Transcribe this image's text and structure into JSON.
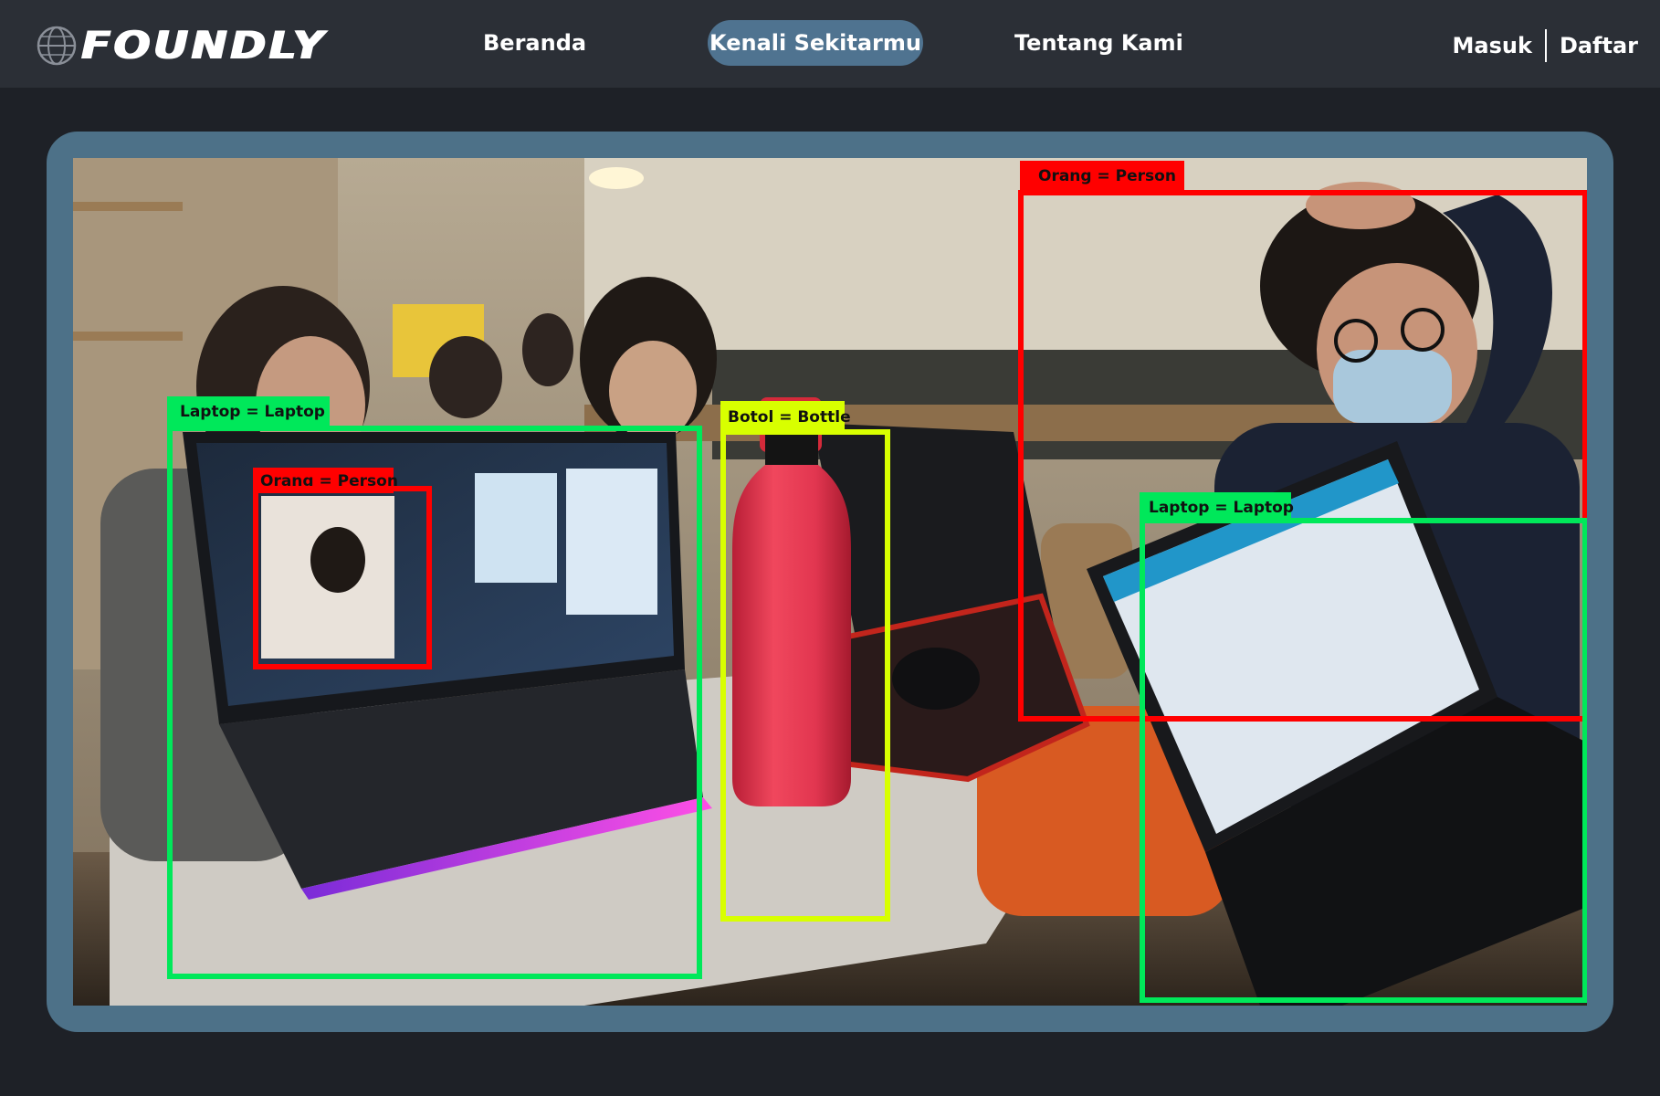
{
  "brand": {
    "name": "FOUNDLY"
  },
  "nav": {
    "items": [
      {
        "label": "Beranda",
        "active": false
      },
      {
        "label": "Kenali Sekitarmu",
        "active": true
      },
      {
        "label": "Tentang Kami",
        "active": false
      }
    ]
  },
  "auth": {
    "login_label": "Masuk",
    "register_label": "Daftar"
  },
  "detections": [
    {
      "label": "Orang = Person",
      "color": "#ff0000"
    },
    {
      "label": "Laptop = Laptop",
      "color": "#00e85a"
    },
    {
      "label": "Orang = Person",
      "color": "#ff0000"
    },
    {
      "label": "Botol = Bottle",
      "color": "#d8ff00"
    },
    {
      "label": "Laptop = Laptop",
      "color": "#00e85a"
    }
  ],
  "colors": {
    "page_background": "#1e2127",
    "navbar_background": "#2b2f36",
    "active_nav_pill": "#4f7390",
    "frame_border": "#4d7188",
    "person_box": "#ff0000",
    "laptop_box": "#00e85a",
    "bottle_box": "#d8ff00"
  },
  "icons": {
    "logo": "globe-icon"
  }
}
